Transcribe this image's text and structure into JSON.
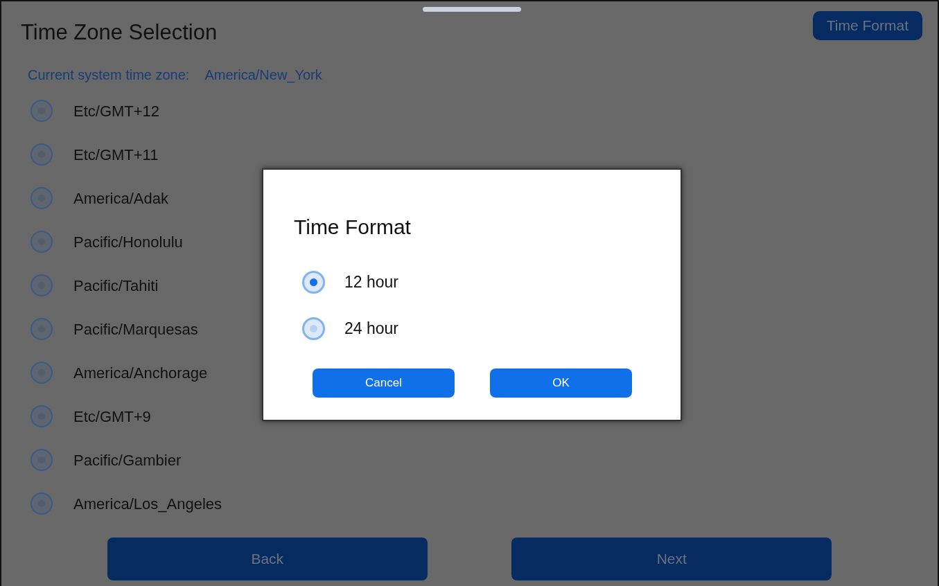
{
  "page": {
    "title": "Time Zone Selection",
    "time_format_button": "Time Format",
    "current_label": "Current system time zone:",
    "current_value": "America/New_York"
  },
  "time_zones": [
    {
      "label": "Etc/GMT+12",
      "selected": false
    },
    {
      "label": "Etc/GMT+11",
      "selected": false
    },
    {
      "label": "America/Adak",
      "selected": false
    },
    {
      "label": "Pacific/Honolulu",
      "selected": false
    },
    {
      "label": "Pacific/Tahiti",
      "selected": false
    },
    {
      "label": "Pacific/Marquesas",
      "selected": false
    },
    {
      "label": "America/Anchorage",
      "selected": false
    },
    {
      "label": "Etc/GMT+9",
      "selected": false
    },
    {
      "label": "Pacific/Gambier",
      "selected": false
    },
    {
      "label": "America/Los_Angeles",
      "selected": false
    }
  ],
  "footer_buttons": [
    "Back",
    "Next"
  ],
  "dialog": {
    "title": "Time Format",
    "options": [
      {
        "label": "12 hour",
        "selected": true
      },
      {
        "label": "24 hour",
        "selected": false
      }
    ],
    "buttons": [
      "Cancel",
      "OK"
    ]
  }
}
